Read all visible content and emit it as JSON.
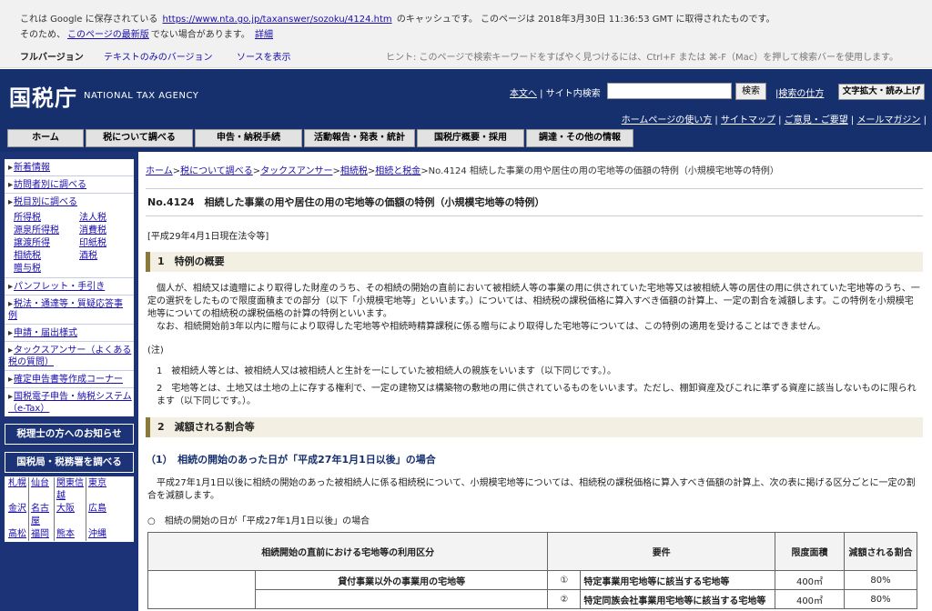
{
  "cache_header": {
    "line1_pre": "これは Google に保存されている",
    "line1_url": "https://www.nta.go.jp/taxanswer/sozoku/4124.htm",
    "line1_post": "のキャッシュです。 このページは 2018年3月30日 11:36:53 GMT に取得されたものです。",
    "line2_pre": "そのため、",
    "line2_link": "このページの最新版",
    "line2_post": "でない場合があります。",
    "line2_detail": "詳細",
    "full_version": "フルバージョン",
    "text_only": "テキストのみのバージョン",
    "view_source": "ソースを表示",
    "hint": "ヒント: このページで検索キーワードをすばやく見つけるには、Ctrl+F または ⌘-F（Mac）を押して検索バーを使用します。"
  },
  "site_header": {
    "logo": "国税庁",
    "logo_en": "NATIONAL TAX AGENCY",
    "link_text": "本文へ",
    "sep": " | ",
    "site_search_label": "サイト内検索",
    "search_button": "検索",
    "search_howto": "検索の仕方",
    "zoom_button": "文字拡大・読み上げ",
    "sublinks": [
      "ホームページの使い方",
      "サイトマップ",
      "ご意見・ご要望",
      "メールマガジン"
    ]
  },
  "nav": {
    "items": [
      "ホーム",
      "税について調べる",
      "申告・納税手続",
      "活動報告・発表・統計",
      "国税庁概要・採用",
      "調達・その他の情報"
    ]
  },
  "sidebar": {
    "items_top": [
      "新着情報",
      "訪問者別に調べる",
      "税目別に調べる"
    ],
    "tax_types": [
      "所得税",
      "法人税",
      "源泉所得税",
      "消費税",
      "譲渡所得",
      "印紙税",
      "相続税",
      "酒税",
      "贈与税"
    ],
    "items_bottom": [
      "パンフレット・手引き",
      "税法・通達等・質疑応答事例",
      "申請・届出様式",
      "タックスアンサー（よくある税の質問）",
      "確定申告書等作成コーナー",
      "国税電子申告・納税システム（e-Tax）"
    ],
    "btn_tax_accountant": "税理士の方へのお知らせ",
    "btn_offices": "国税局・税務署を調べる",
    "cities": [
      "札幌",
      "仙台",
      "関東信越",
      "東京",
      "金沢",
      "名古屋",
      "大阪",
      "広島",
      "高松",
      "福岡",
      "熊本",
      "沖縄"
    ]
  },
  "main": {
    "breadcrumb": [
      "ホーム",
      "税について調べる",
      "タックスアンサー",
      "相続税",
      "相続と税金"
    ],
    "breadcrumb_sep": ">",
    "breadcrumb_current": "No.4124 相続した事業の用や居住の用の宅地等の価額の特例（小規模宅地等の特例）",
    "title": "No.4124　相続した事業の用や居住の用の宅地等の価額の特例（小規模宅地等の特例）",
    "as_of": "[平成29年4月1日現在法令等]",
    "section1": "1　特例の概要",
    "para1": "　個人が、相続又は遺贈により取得した財産のうち、その相続の開始の直前において被相続人等の事業の用に供されていた宅地等又は被相続人等の居住の用に供されていた宅地等のうち、一定の選択をしたもので限度面積までの部分（以下「小規模宅地等」といいます。）については、相続税の課税価格に算入すべき価額の計算上、一定の割合を減額します。この特例を小規模宅地等についての相続税の課税価格の計算の特例といいます。",
    "para2": "　なお、相続開始前3年以内に贈与により取得した宅地等や相続時精算課税に係る贈与により取得した宅地等については、この特例の適用を受けることはできません。",
    "note_head": "(注)",
    "note1": "1　被相続人等とは、被相続人又は被相続人と生計を一にしていた被相続人の親族をいいます（以下同じです。）。",
    "note2": "2　宅地等とは、土地又は土地の上に存する権利で、一定の建物又は構築物の敷地の用に供されているものをいいます。ただし、棚卸資産及びこれに準ずる資産に該当しないものに限られます（以下同じです。）。",
    "section2": "2　減額される割合等",
    "subsection": "（1）　相続の開始のあった日が「平成27年1月1日以後」の場合",
    "para3": "　平成27年1月1日以後に相続の開始のあった被相続人に係る相続税について、小規模宅地等については、相続税の課税価格に算入すべき価額の計算上、次の表に掲げる区分ごとに一定の割合を減額します。",
    "table_caption": "○　相続の開始の日が「平成27年1月1日以後」の場合",
    "table": {
      "headers": [
        "相続開始の直前における宅地等の利用区分",
        "要件",
        "限度面積",
        "減額される割合"
      ],
      "rows": [
        [
          "貸付事業以外の事業用の宅地等",
          "①",
          "特定事業用宅地等に該当する宅地等",
          "400㎡",
          "80%"
        ],
        [
          "",
          "②",
          "特定同族会社事業用宅地等に該当する宅地等",
          "400㎡",
          "80%"
        ]
      ]
    }
  }
}
